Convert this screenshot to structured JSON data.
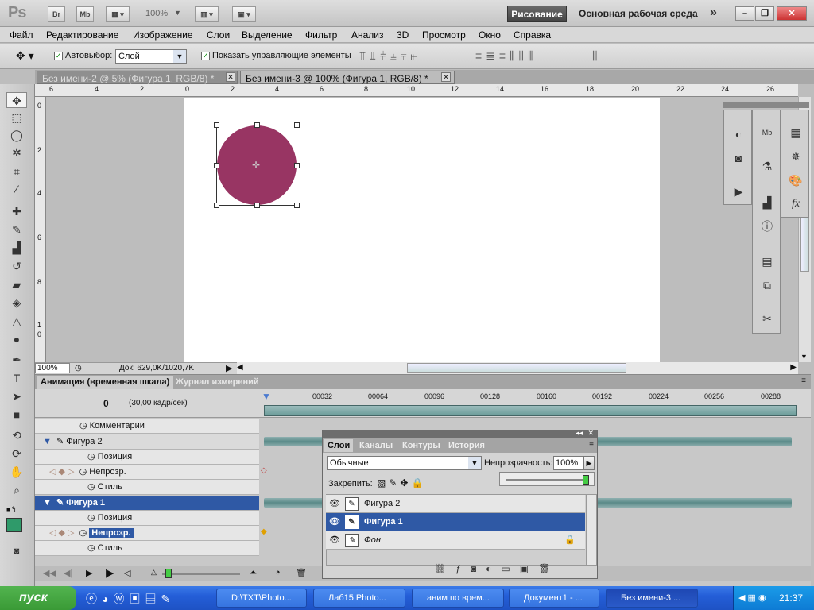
{
  "app": {
    "logo": "Ps",
    "br": "Br",
    "mb": "Mb",
    "zoom": "100%",
    "workspace_active": "Рисование",
    "workspace_main": "Основная рабочая среда",
    "more": "»"
  },
  "window_controls": {
    "minimize": "–",
    "restore": "❐",
    "close": "✕"
  },
  "menu": [
    "Файл",
    "Редактирование",
    "Изображение",
    "Слои",
    "Выделение",
    "Фильтр",
    "Анализ",
    "3D",
    "Просмотр",
    "Окно",
    "Справка"
  ],
  "options": {
    "autoselect_label": "Автовыбор:",
    "autoselect_value": "Слой",
    "show_controls_label": "Показать управляющие элементы"
  },
  "doc_tabs": [
    {
      "title": "Без имени-2 @ 5% (Фигура 1, RGB/8) *"
    },
    {
      "title": "Без имени-3 @ 100% (Фигура 1, RGB/8) *"
    }
  ],
  "ruler_h": [
    "6",
    "4",
    "2",
    "0",
    "2",
    "4",
    "6",
    "8",
    "10",
    "12",
    "14",
    "16",
    "18",
    "20",
    "22",
    "24",
    "26"
  ],
  "ruler_v": [
    "0",
    "2",
    "4",
    "6",
    "8",
    "1",
    "0"
  ],
  "status": {
    "zoom": "100%",
    "doc": "Док: 629,0K/1020,7K"
  },
  "anim_panel": {
    "tab_anim": "Анимация (временная шкала)",
    "tab_measure": "Журнал измерений",
    "frame": "0",
    "fps": "(30,00 кадр/сек)",
    "ticks": [
      "00032",
      "00064",
      "00096",
      "00128",
      "00160",
      "00192",
      "00224",
      "00256",
      "00288"
    ],
    "rows": [
      {
        "label": "Комментарии"
      },
      {
        "label": "Фигура 2"
      },
      {
        "label": "Позиция"
      },
      {
        "label": "Непрозр."
      },
      {
        "label": "Стиль"
      },
      {
        "label": "Фигура 1"
      },
      {
        "label": "Позиция"
      },
      {
        "label": "Непрозр."
      },
      {
        "label": "Стиль"
      }
    ]
  },
  "layers_panel": {
    "tabs": [
      "Слои",
      "Каналы",
      "Контуры",
      "История"
    ],
    "blend": "Обычные",
    "opacity_label": "Непрозрачность:",
    "opacity_value": "100%",
    "lock_label": "Закрепить:",
    "layers": [
      "Фигура 2",
      "Фигура 1",
      "Фон"
    ]
  },
  "taskbar": {
    "start": "пуск",
    "tasks": [
      "D:\\TXT\\Photo...",
      "Лаб15 Photo...",
      "аним по врем...",
      "Документ1 - ...",
      "Без имени-3 ..."
    ],
    "time": "21:37"
  },
  "colors": {
    "circle": "#983563",
    "foreground": "#2f9a6a",
    "selection": "#2f59a5"
  }
}
